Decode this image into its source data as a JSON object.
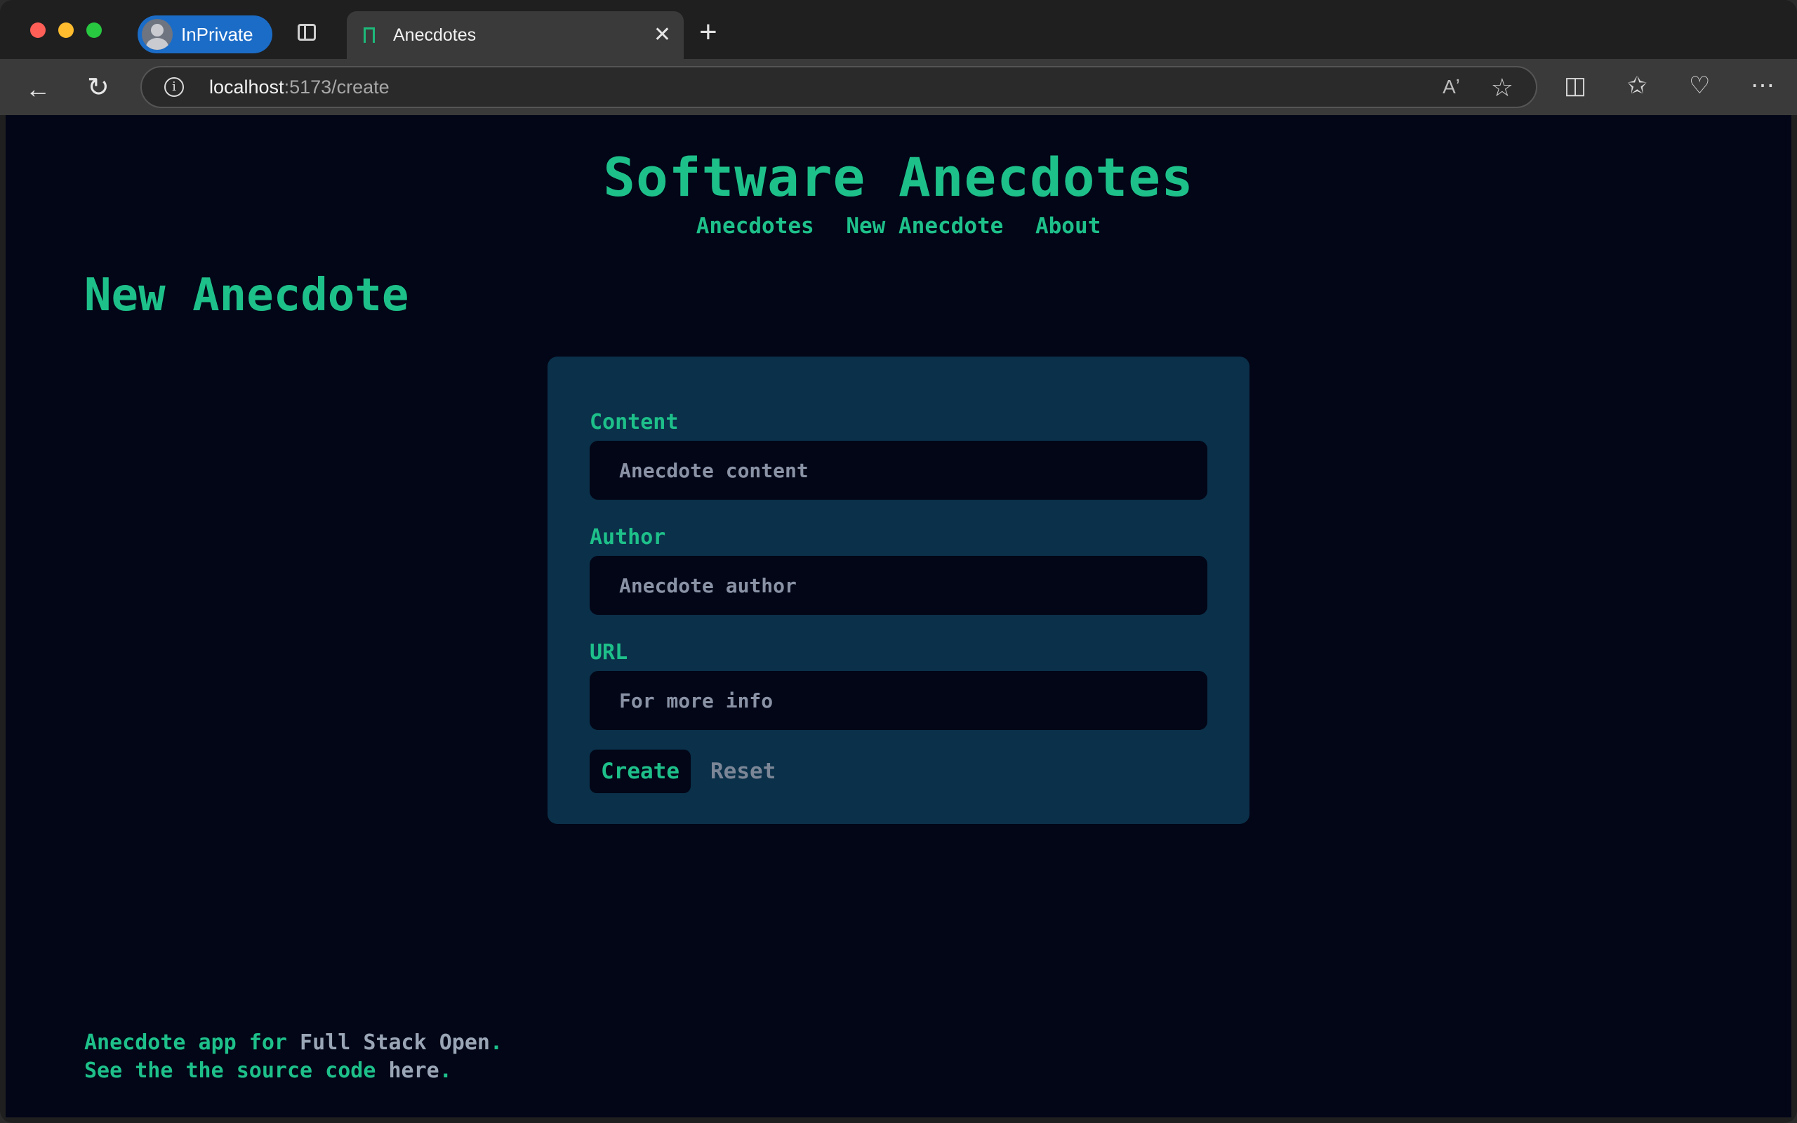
{
  "browser": {
    "inprivate_label": "InPrivate",
    "tab_title": "Anecdotes",
    "tab_close": "✕",
    "new_tab": "+",
    "url_host": "localhost",
    "url_path": ":5173/create"
  },
  "site": {
    "title": "Software Anecdotes",
    "nav": [
      "Anecdotes",
      "New Anecdote",
      "About"
    ]
  },
  "page": {
    "heading": "New Anecdote"
  },
  "form": {
    "content_label": "Content",
    "content_placeholder": "Anecdote content",
    "author_label": "Author",
    "author_placeholder": "Anecdote author",
    "url_label": "URL",
    "url_placeholder": "For more info",
    "create_label": "Create",
    "reset_label": "Reset"
  },
  "footer": {
    "line1_prefix": "Anecdote app for ",
    "line1_link": "Full Stack Open",
    "line1_suffix": ".",
    "line2_prefix": "See the the source code ",
    "line2_link": "here",
    "line2_suffix": "."
  },
  "colors": {
    "accent": "#1ec08a",
    "page_bg": "#020617",
    "card_bg": "#0b3049",
    "muted": "#8a93a6"
  }
}
